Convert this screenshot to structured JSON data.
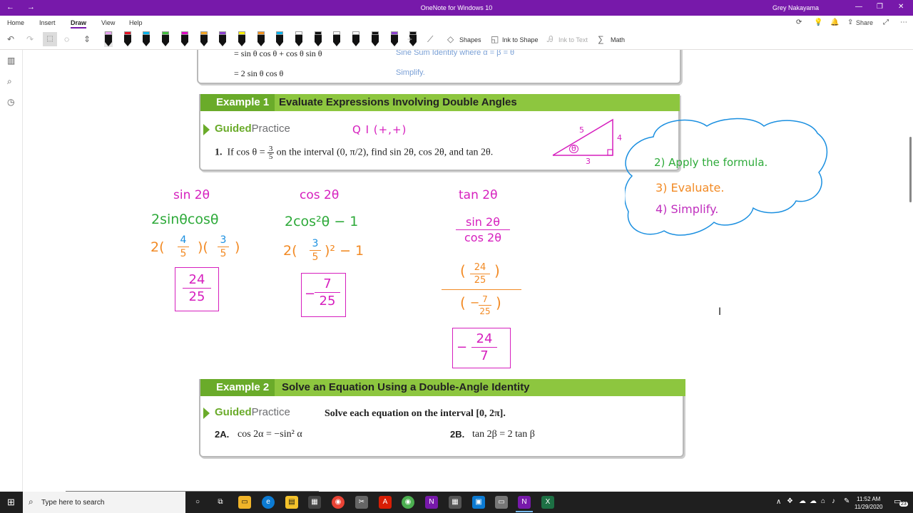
{
  "window": {
    "title": "OneNote for Windows 10",
    "user": "Grey Nakayama",
    "back_icon": "back-arrow-icon",
    "forward_icon": "forward-arrow-icon"
  },
  "ribbon": {
    "tabs": [
      "Home",
      "Insert",
      "Draw",
      "View",
      "Help"
    ],
    "active_tab": "Draw",
    "share": "Share"
  },
  "toolbar": {
    "shapes": "Shapes",
    "ink_to_shape": "Ink to Shape",
    "ink_to_text": "Ink to Text",
    "math": "Math",
    "pen_colors": [
      "#e9a3f2",
      "#e81123",
      "#00b7ef",
      "#41c33c",
      "#e300c8",
      "#f7a823",
      "#8e3fd3",
      "#fff200",
      "#f7941d",
      "#00b4f0",
      "#ffffff",
      "#111111",
      "#ffffff",
      "#ffffff",
      "#111111",
      "#8e3fd3",
      "#111111"
    ]
  },
  "page": {
    "prev_lines": {
      "line1": "= sin θ cos θ + cos θ sin θ",
      "note1": "Sine Sum Identity where α = β = θ",
      "line2": "= 2 sin θ cos θ",
      "note2": "Simplify."
    },
    "example1": {
      "label": "Example 1",
      "title": "Evaluate Expressions Involving Double Angles",
      "gp_guided": "Guided",
      "gp_practice": "Practice",
      "problem_num": "1.",
      "problem_a": "If cos θ = ",
      "problem_frac_n": "3",
      "problem_frac_d": "5",
      "problem_b": " on the interval ",
      "problem_interval": "(0, π/2)",
      "problem_c": ", find sin 2θ, cos 2θ, and tan 2θ."
    },
    "example2": {
      "label": "Example 2",
      "title": "Solve an Equation Using a Double-Angle Identity",
      "gp_guided": "Guided",
      "gp_practice": "Practice",
      "instruction": "Solve each equation on the interval [0, 2π].",
      "a_num": "2A.",
      "a_eq": "cos 2α = −sin² α",
      "b_num": "2B.",
      "b_eq": "tan 2β = 2 tan β"
    }
  },
  "ink": {
    "quadrant": "Q I  (+,+)",
    "tri_hyp": "5",
    "tri_opp": "4",
    "tri_adj": "3",
    "tri_angle": "θ",
    "sin_head": "sin 2θ",
    "sin_formula": "2sinθcosθ",
    "sin_sub_pre": "2(",
    "sin_f1n": "4",
    "sin_f1d": "5",
    "sin_sub_mid": ")(",
    "sin_f2n": "3",
    "sin_f2d": "5",
    "sin_sub_post": ")",
    "sin_ans_n": "24",
    "sin_ans_d": "25",
    "cos_head": "cos 2θ",
    "cos_formula": "2cos²θ − 1",
    "cos_sub_pre": "2(",
    "cos_fn": "3",
    "cos_fd": "5",
    "cos_sub_post": ")² − 1",
    "cos_ans_sign": "−",
    "cos_ans_n": "7",
    "cos_ans_d": "25",
    "tan_head": "tan 2θ",
    "tan_num": "sin 2θ",
    "tan_den": "cos 2θ",
    "tan_big_n_n": "24",
    "tan_big_n_d": "25",
    "tan_big_d_sign": "−",
    "tan_big_d_n": "7",
    "tan_big_d_d": "25",
    "tan_ans_sign": "−",
    "tan_ans_n": "24",
    "tan_ans_d": "7",
    "steps": [
      "2)  Apply the formula.",
      "3)  Evaluate.",
      "4)  Simplify."
    ]
  },
  "taskbar": {
    "search_placeholder": "Type here to search",
    "time": "11:52 AM",
    "date": "11/29/2020",
    "notifications": "23"
  }
}
